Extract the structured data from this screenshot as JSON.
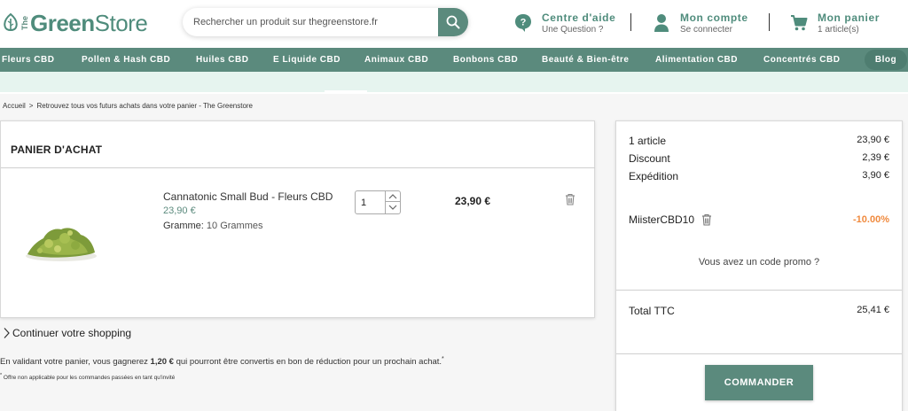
{
  "brand": {
    "the": "The",
    "green": "Green",
    "store": "Store",
    "color": "#4f8c7c"
  },
  "search": {
    "placeholder": "Rechercher un produit sur thegreenstore.fr",
    "icon": "search-icon"
  },
  "header": {
    "help": {
      "title": "Centre d'aide",
      "subtitle": "Une Question ?",
      "icon": "chat-question-icon"
    },
    "account": {
      "title": "Mon compte",
      "subtitle": "Se connecter",
      "icon": "user-icon"
    },
    "cart": {
      "title": "Mon panier",
      "subtitle": "1 article(s)",
      "icon": "cart-icon"
    }
  },
  "nav": {
    "items": [
      "Fleurs CBD",
      "Pollen & Hash CBD",
      "Huiles CBD",
      "E Liquide CBD",
      "Animaux CBD",
      "Bonbons CBD",
      "Beauté & Bien-être",
      "Alimentation CBD",
      "Concentrés CBD"
    ],
    "blog": "Blog"
  },
  "breadcrumb": {
    "home": "Accueil",
    "separator": ">",
    "current": "Retrouvez tous vos futurs achats dans votre panier - The Greenstore"
  },
  "cart": {
    "title": "PANIER D'ACHAT",
    "item": {
      "name": "Cannatonic Small Bud - Fleurs CBD",
      "unit_price": "23,90 €",
      "attr_label": "Gramme:",
      "attr_value": "10 Grammes",
      "quantity": "1",
      "line_total": "23,90 €"
    },
    "continue": "Continuer votre shopping",
    "loyalty_before": "En validant votre panier, vous gagnerez ",
    "loyalty_amount": "1,20 €",
    "loyalty_after": " qui pourront être convertis en bon de réduction pour un prochain achat.",
    "loyalty_mark": "*",
    "loyalty_note": "Offre non applicable pour les commandes passées en tant qu'invité"
  },
  "summary": {
    "articles_label": "1 article",
    "articles_value": "23,90 €",
    "discount_label": "Discount",
    "discount_value": "2,39 €",
    "shipping_label": "Expédition",
    "shipping_value": "3,90 €",
    "coupon_code": "MiisterCBD10",
    "coupon_value": "-10.00%",
    "promo_link": "Vous avez un code promo ?",
    "total_label": "Total TTC",
    "total_value": "25,41 €",
    "order_button": "COMMANDER"
  },
  "colors": {
    "primary": "#5b8a7d",
    "accent_orange": "#f08a3e",
    "subnav": "#e6f4ef"
  }
}
